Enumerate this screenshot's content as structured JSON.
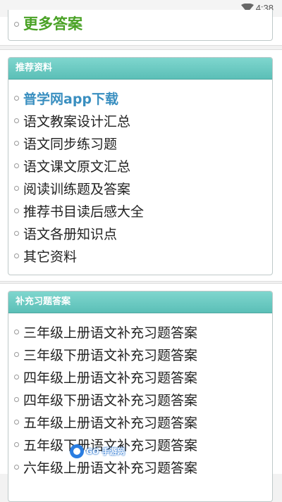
{
  "status_bar": {
    "time": "4:38"
  },
  "top_card": {
    "link": "更多答案"
  },
  "recommended": {
    "title": "推荐资料",
    "items": [
      {
        "label": "普学网app下载",
        "highlight": true
      },
      {
        "label": "语文教案设计汇总"
      },
      {
        "label": "语文同步练习题"
      },
      {
        "label": "语文课文原文汇总"
      },
      {
        "label": "阅读训练题及答案"
      },
      {
        "label": "推荐书目读后感大全"
      },
      {
        "label": "语文各册知识点"
      },
      {
        "label": "其它资料"
      }
    ]
  },
  "supplement": {
    "title": "补充习题答案",
    "items": [
      "三年级上册语文补充习题答案",
      "三年级下册语文补充习题答案",
      "四年级上册语文补充习题答案",
      "四年级下册语文补充习题答案",
      "五年级上册语文补充习题答案",
      "五年级下册语文补充习题答案",
      "六年级上册语文补充习题答案"
    ]
  },
  "watermark": {
    "text": "GO 手游网"
  }
}
